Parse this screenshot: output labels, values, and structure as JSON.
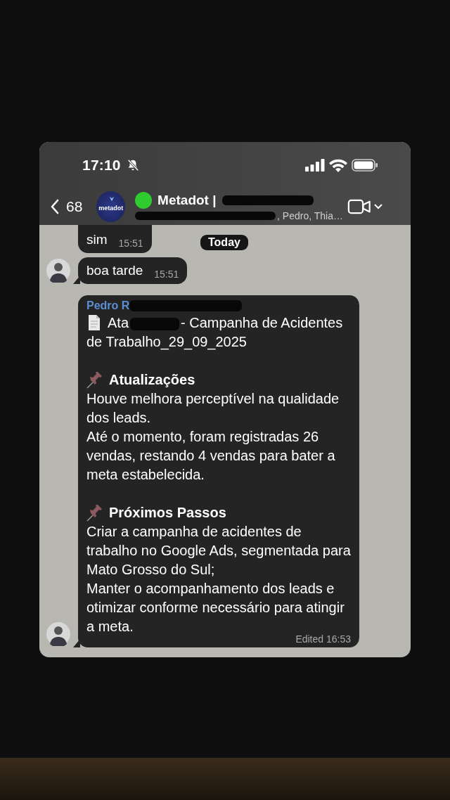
{
  "status_bar": {
    "time": "17:10",
    "muted": true
  },
  "header": {
    "back_count": "68",
    "avatar_text": "metadot",
    "title": "Metadot |",
    "subtitle": ", Pedro, Thia…"
  },
  "date_pill": "Today",
  "messages": [
    {
      "kind": "text",
      "text": "sim",
      "time": "15:51",
      "avatar": false
    },
    {
      "kind": "text",
      "text": "boa tarde",
      "time": "15:51",
      "avatar": true
    },
    {
      "kind": "document",
      "avatar": true,
      "sender": "Pedro R",
      "title_start": "Ata",
      "title_rest": "- Campanha de Acidentes de Trabalho_29_09_2025",
      "sections": [
        {
          "heading": "Atualizações",
          "lines": [
            "Houve melhora perceptível na qualidade dos leads.",
            "Até o momento, foram registradas 26 vendas, restando 4 vendas para bater a meta estabelecida."
          ]
        },
        {
          "heading": "Próximos Passos",
          "lines": [
            "Criar a campanha de acidentes de trabalho no Google Ads, segmentada para Mato Grosso do Sul;",
            "Manter o acompanhamento dos leads e otimizar conforme necessário para atingir a meta."
          ]
        }
      ],
      "time": "Edited 16:53"
    }
  ]
}
